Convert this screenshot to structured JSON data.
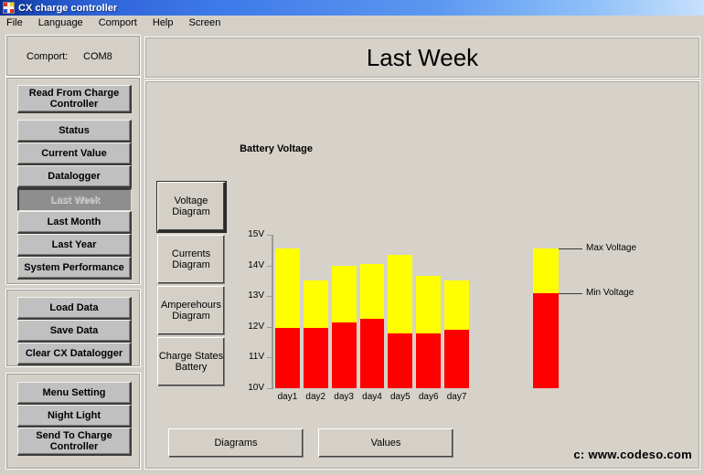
{
  "window": {
    "title": "CX charge controller",
    "icon": "app-icon"
  },
  "menu": {
    "items": [
      "File",
      "Language",
      "Comport",
      "Help",
      "Screen"
    ]
  },
  "sidebar": {
    "comport": {
      "label": "Comport:",
      "value": "COM8"
    },
    "read_button": "Read From Charge\nController",
    "nav_items": [
      {
        "label": "Status",
        "state": "normal"
      },
      {
        "label": "Current Value",
        "state": "normal"
      },
      {
        "label": "Datalogger",
        "state": "normal"
      },
      {
        "label": "Last Week",
        "state": "pressed"
      },
      {
        "label": "Last Month",
        "state": "normal"
      },
      {
        "label": "Last Year",
        "state": "normal"
      },
      {
        "label": "System Performance",
        "state": "normal"
      }
    ],
    "data_items": [
      {
        "label": "Load Data"
      },
      {
        "label": "Save Data"
      },
      {
        "label": "Clear CX Datalogger"
      }
    ],
    "settings_items": [
      {
        "label": "Menu Setting"
      },
      {
        "label": "Night Light"
      },
      {
        "label": "Send To Charge\nController"
      }
    ]
  },
  "main": {
    "page_title": "Last Week",
    "diagram_buttons": [
      {
        "label": "Voltage\nDiagram",
        "selected": true
      },
      {
        "label": "Currents\nDiagram",
        "selected": false
      },
      {
        "label": "Amperehours\nDiagram",
        "selected": false
      },
      {
        "label": "Charge States\nBattery",
        "selected": false
      }
    ],
    "bottom_buttons": [
      {
        "label": "Diagrams"
      },
      {
        "label": "Values"
      }
    ],
    "credit": "c: www.codeso.com"
  },
  "chart_data": {
    "type": "bar",
    "title": "Battery Voltage",
    "xlabel": "",
    "ylabel": "",
    "ylim": [
      10,
      15
    ],
    "ytick_labels": [
      "15V",
      "14V",
      "13V",
      "12V",
      "11V",
      "10V"
    ],
    "ytick_values": [
      15,
      14,
      13,
      12,
      11,
      10
    ],
    "grid": false,
    "categories": [
      "day1",
      "day2",
      "day3",
      "day4",
      "day5",
      "day6",
      "day7"
    ],
    "series": [
      {
        "name": "Max Voltage",
        "color": "#ffff00",
        "values": [
          14.55,
          13.5,
          14.0,
          14.05,
          14.35,
          13.65,
          13.5
        ]
      },
      {
        "name": "Min Voltage",
        "color": "#ff0000",
        "values": [
          11.95,
          11.95,
          12.15,
          12.25,
          11.8,
          11.8,
          11.9
        ]
      }
    ],
    "legend_position": "right",
    "legend": [
      {
        "label": "Max Voltage",
        "color": "#ffff00"
      },
      {
        "label": "Min Voltage",
        "color": "#ff0000"
      }
    ],
    "legend_bar": {
      "max": 14.55,
      "min": 13.1,
      "base": 10
    }
  },
  "colors": {
    "bar_max": "#ffff00",
    "bar_min": "#ff0000",
    "window_bg": "#d4d0c8",
    "panel_bg": "#d6d2ca",
    "button_bg": "#c0c0c0",
    "titlebar": "#2f63d8"
  }
}
